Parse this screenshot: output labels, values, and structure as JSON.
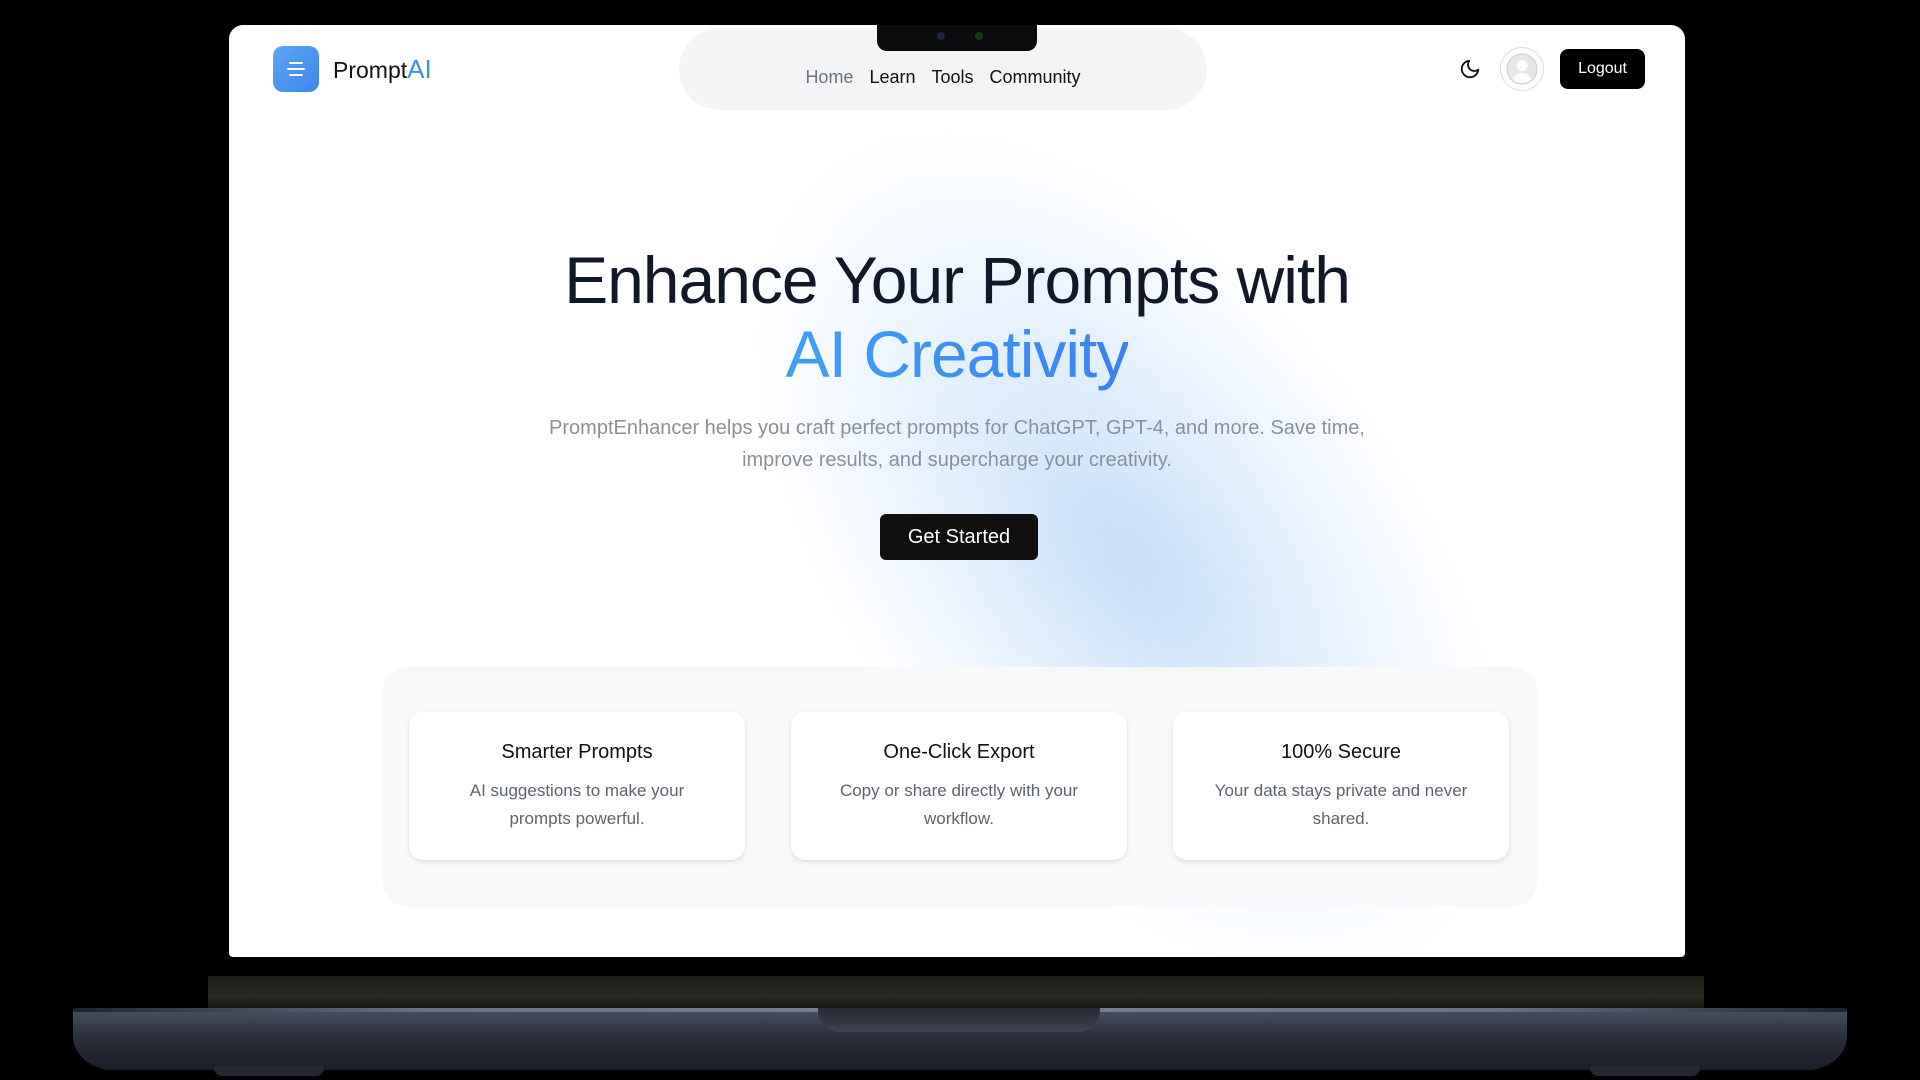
{
  "brand": {
    "name": "Prompt",
    "suffix": "AI"
  },
  "nav": {
    "items": [
      "Home",
      "Learn",
      "Tools",
      "Community"
    ],
    "active": "Home"
  },
  "header": {
    "logout_label": "Logout"
  },
  "hero": {
    "title_line1": "Enhance Your Prompts with",
    "title_line2": "AI Creativity",
    "subtitle": "PromptEnhancer helps you craft perfect prompts for ChatGPT, GPT-4, and more. Save time, improve results, and supercharge your creativity.",
    "cta_label": "Get Started"
  },
  "features": [
    {
      "title": "Smarter Prompts",
      "description": "AI suggestions to make your prompts powerful."
    },
    {
      "title": "One-Click Export",
      "description": "Copy or share directly with your workflow."
    },
    {
      "title": "100% Secure",
      "description": "Your data stays private and never shared."
    }
  ],
  "icons": {
    "logo": "menu-lines-icon",
    "theme": "moon-icon",
    "avatar": "user-circle-icon"
  },
  "colors": {
    "accent": "#3b8ff0",
    "cta_background": "#0f0f10",
    "nav_pill": "#f3f4f6",
    "panel": "#f7f8fa"
  }
}
